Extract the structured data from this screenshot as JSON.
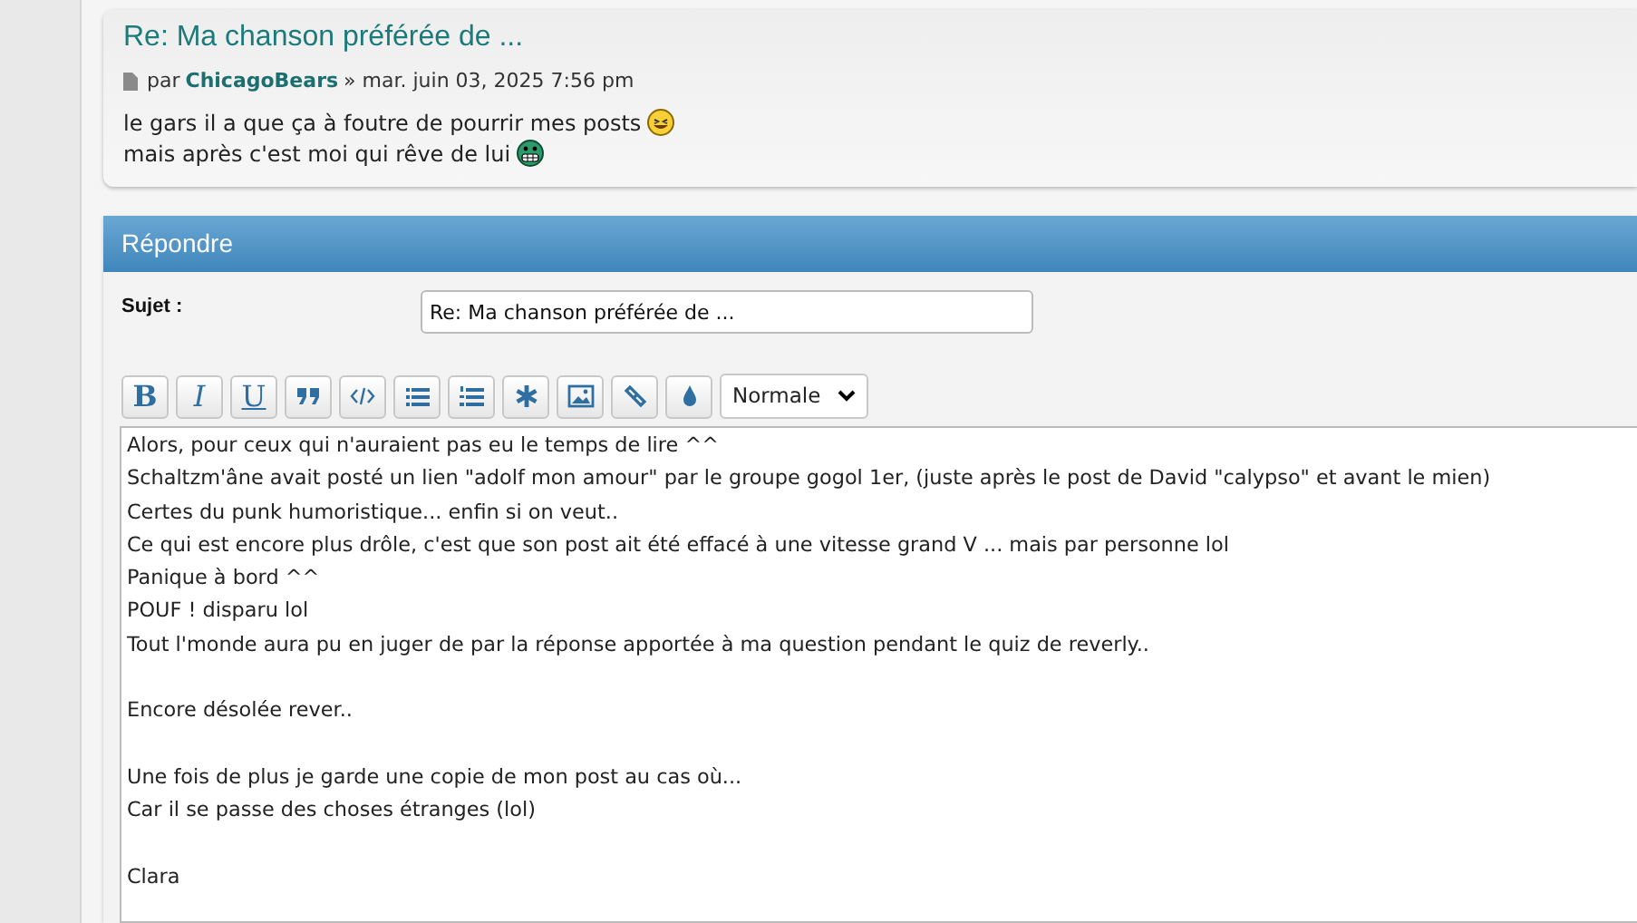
{
  "post": {
    "title": "Re: Ma chanson préférée de ...",
    "by": "par",
    "author": "ChicagoBears",
    "date": "» mar. juin 03, 2025 7:56 pm",
    "lines": [
      "le gars il a que ça à foutre de pourrir mes posts",
      "mais après c'est moi qui rêve de lui"
    ]
  },
  "reply": {
    "title": "Répondre",
    "subject_label": "Sujet :",
    "subject_value": "Re: Ma chanson préférée de ...",
    "toolbar": [
      {
        "kind": "text",
        "label": "B"
      },
      {
        "kind": "text",
        "label": "I"
      },
      {
        "kind": "text",
        "label": "U"
      },
      {
        "kind": "icon"
      },
      {
        "kind": "icon"
      },
      {
        "kind": "icon"
      },
      {
        "kind": "icon"
      },
      {
        "kind": "icon"
      },
      {
        "kind": "icon"
      },
      {
        "kind": "icon"
      },
      {
        "kind": "icon"
      }
    ],
    "size_select": "Normale",
    "message": "Alors, pour ceux qui n'auraient pas eu le temps de lire ^^\nSchaltzm'âne avait posté un lien \"adolf mon amour\" par le groupe gogol 1er, (juste après le post de David \"calypso\" et avant le mien)\nCertes du punk humoristique... enfin si on veut..\nCe qui est encore plus drôle, c'est que son post ait été effacé à une vitesse grand V  ... mais par personne lol\nPanique à bord ^^\nPOUF ! disparu lol\nTout l'monde aura pu en juger de par la réponse apportée à ma question pendant le quiz de reverly..\n\nEncore désolée rever..\n\nUne fois de plus je garde une copie de mon post au cas où...\nCar il se passe des choses étranges (lol)\n\nClara"
  }
}
